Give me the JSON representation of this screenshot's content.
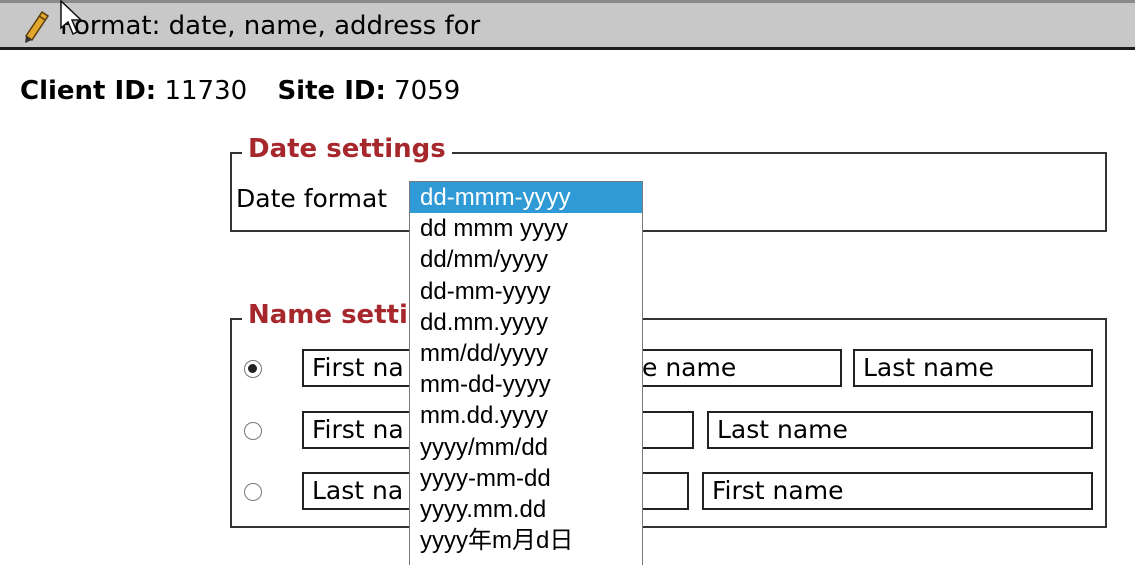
{
  "titlebar": {
    "title": "Format: date, name, address for"
  },
  "ids": {
    "client_label": "Client ID:",
    "client_value": "11730",
    "site_label": "Site ID:",
    "site_value": "7059"
  },
  "date_settings": {
    "legend": "Date settings",
    "label": "Date format",
    "options": [
      "dd-mmm-yyyy",
      "dd mmm yyyy",
      "dd/mm/yyyy",
      "dd-mm-yyyy",
      "dd.mm.yyyy",
      "mm/dd/yyyy",
      "mm-dd-yyyy",
      "mm.dd.yyyy",
      "yyyy/mm/dd",
      "yyyy-mm-dd",
      "yyyy.mm.dd",
      "yyyy年m月d日"
    ],
    "selected_index": 0
  },
  "name_settings": {
    "legend": "Name setti",
    "rows": [
      {
        "selected": true,
        "fields": [
          "First na",
          "e name",
          "Last name"
        ]
      },
      {
        "selected": false,
        "fields": [
          "First na",
          "",
          "Last name"
        ]
      },
      {
        "selected": false,
        "fields": [
          "Last na",
          "",
          "First name"
        ]
      }
    ]
  },
  "icons": {
    "title_icon": "pencil-icon",
    "pointer": "mouse-cursor-icon"
  },
  "colors": {
    "legend": "#a6272c",
    "selection": "#2f9ad6",
    "titlebar": "#c8c8c8"
  }
}
